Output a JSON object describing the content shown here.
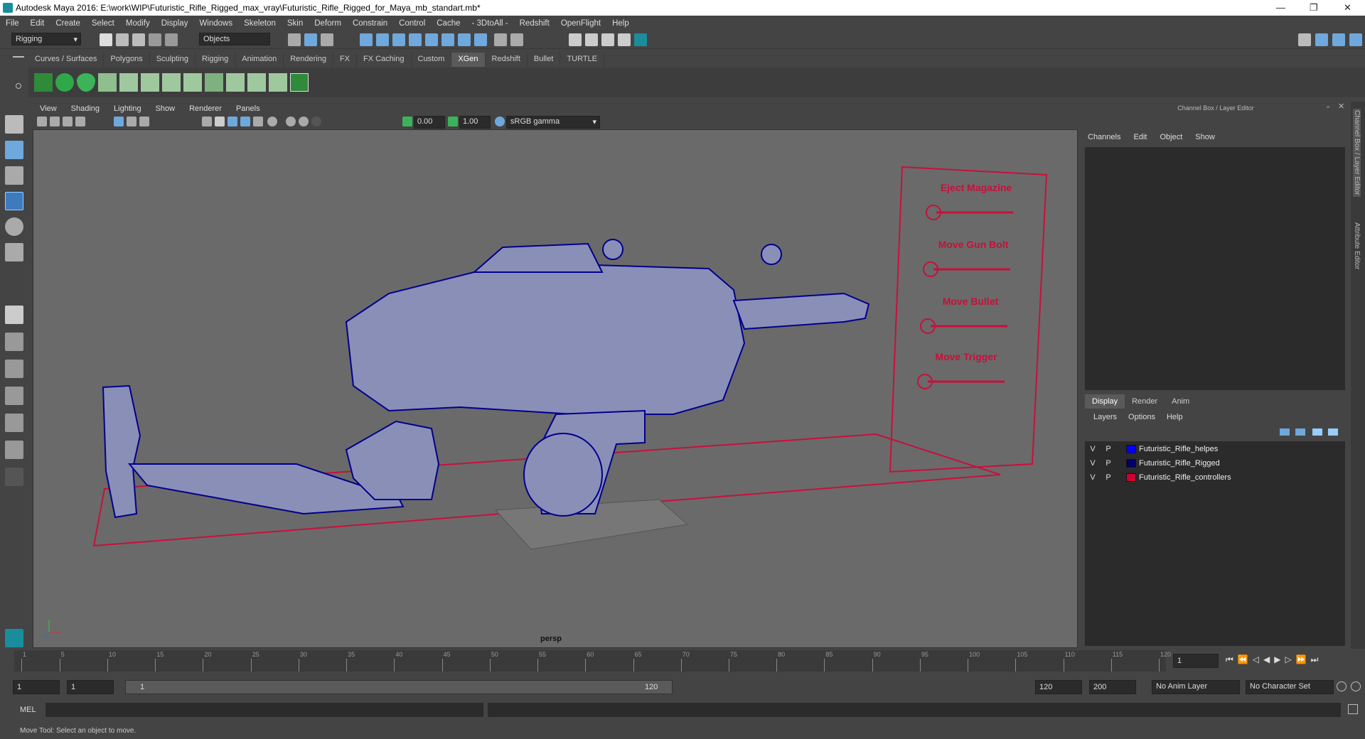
{
  "title": "Autodesk Maya 2016: E:\\work\\WIP\\Futuristic_Rifle_Rigged_max_vray\\Futuristic_Rifle_Rigged_for_Maya_mb_standart.mb*",
  "menus": [
    "File",
    "Edit",
    "Create",
    "Select",
    "Modify",
    "Display",
    "Windows",
    "Skeleton",
    "Skin",
    "Deform",
    "Constrain",
    "Control",
    "Cache",
    "- 3DtoAll -",
    "Redshift",
    "OpenFlight",
    "Help"
  ],
  "statusline": {
    "mode": "Rigging",
    "select_mode": "Objects"
  },
  "shelf_tabs": [
    "Curves / Surfaces",
    "Polygons",
    "Sculpting",
    "Rigging",
    "Animation",
    "Rendering",
    "FX",
    "FX Caching",
    "Custom",
    "XGen",
    "Redshift",
    "Bullet",
    "TURTLE"
  ],
  "shelf_active": "XGen",
  "viewport": {
    "menus": [
      "View",
      "Shading",
      "Lighting",
      "Show",
      "Renderer",
      "Panels"
    ],
    "exposure": "0.00",
    "gamma": "1.00",
    "color_space": "sRGB gamma",
    "camera": "persp",
    "controls": [
      "Eject Magazine",
      "Move Gun Bolt",
      "Move Bullet",
      "Move Trigger"
    ]
  },
  "channel_box": {
    "header": "Channel Box / Layer Editor",
    "menus": [
      "Channels",
      "Edit",
      "Object",
      "Show"
    ]
  },
  "layer_editor": {
    "tabs": [
      "Display",
      "Render",
      "Anim"
    ],
    "active_tab": "Display",
    "menus": [
      "Layers",
      "Options",
      "Help"
    ],
    "layers": [
      {
        "v": "V",
        "p": "P",
        "name": "Futuristic_Rifle_helpes",
        "color": "#0000ff"
      },
      {
        "v": "V",
        "p": "P",
        "name": "Futuristic_Rifle_Rigged",
        "color": "#000066"
      },
      {
        "v": "V",
        "p": "P",
        "name": "Futuristic_Rifle_controllers",
        "color": "#cc0033"
      }
    ]
  },
  "side_tabs": [
    "Channel Box / Layer Editor",
    "Attribute Editor"
  ],
  "timeline": {
    "ticks": [
      "1",
      "5",
      "10",
      "15",
      "20",
      "25",
      "30",
      "35",
      "40",
      "45",
      "50",
      "55",
      "60",
      "65",
      "70",
      "75",
      "80",
      "85",
      "90",
      "95",
      "100",
      "105",
      "110",
      "115",
      "120"
    ],
    "current_frame": "1"
  },
  "range": {
    "start": "1",
    "playback_start": "1",
    "slider_start": "1",
    "slider_end": "120",
    "playback_end": "120",
    "end": "200",
    "anim_layer": "No Anim Layer",
    "character_set": "No Character Set"
  },
  "command": {
    "label": "MEL"
  },
  "help_line": "Move Tool: Select an object to move.",
  "colors": {
    "wire": "#00008b",
    "controls": "#c8103a",
    "accent": "#1a8d9c"
  }
}
